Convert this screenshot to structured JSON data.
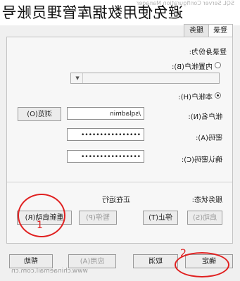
{
  "overlay_title": "避免使用数据库管理员账号",
  "watermark_top": "SQL Server Configuration Manager",
  "tabs": {
    "logon": "登录",
    "service": "服务"
  },
  "logon_as_label": "登录身份为:",
  "builtin_account": {
    "label": "内置帐户(B):"
  },
  "this_account": {
    "label": "本帐户(H):"
  },
  "account_name": {
    "label": "帐户名(N):",
    "value": "/sqladmin",
    "browse_label": "浏览(O)"
  },
  "password": {
    "label": "密码(A):",
    "value": "••••••••••••••••"
  },
  "confirm_password": {
    "label": "确认密码(C):",
    "value": "••••••••••••••••"
  },
  "service_status": {
    "label": "服务状态:",
    "value": "正在运行"
  },
  "service_buttons": {
    "start": "启动(S)",
    "stop": "停止(T)",
    "pause": "暂停(P)",
    "restart": "重新启动(R)"
  },
  "dialog_buttons": {
    "ok": "确定",
    "cancel": "取消",
    "apply": "应用(A)",
    "help": "帮助"
  },
  "annotations": {
    "restart_marker": "1",
    "ok_marker": "2",
    "color": "#e02020"
  },
  "watermark_bottom": "www.chinaemail.com.cn"
}
